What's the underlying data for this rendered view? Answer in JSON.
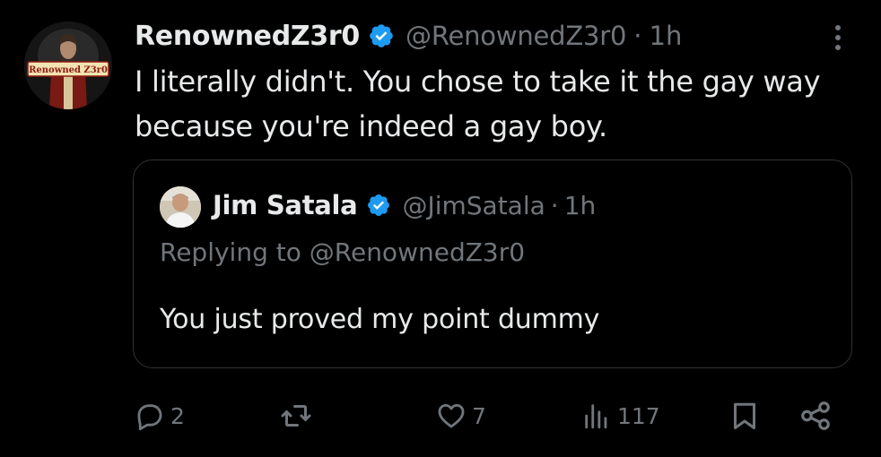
{
  "tweet": {
    "display_name": "RenownedZ3r0",
    "handle": "@RenownedZ3r0",
    "separator": "·",
    "time": "1h",
    "avatar_text": "Renowned Z3r0",
    "text": "I literally didn't. You chose to take it the gay way because you're indeed a gay boy."
  },
  "quote": {
    "display_name": "Jim Satala",
    "handle": "@JimSatala",
    "separator": "·",
    "time": "1h",
    "replying_to_label": "Replying to",
    "replying_to_handle": "@RenownedZ3r0",
    "text": "You just proved my point dummy"
  },
  "actions": {
    "reply_count": "2",
    "repost_count": "",
    "like_count": "7",
    "views_count": "117"
  },
  "colors": {
    "background": "#000000",
    "primary_text": "#e7e9ea",
    "secondary_text": "#71767b",
    "verified_blue": "#1d9bf0",
    "border": "#2f3336"
  },
  "icons": {
    "verified": "verified-badge-icon",
    "more": "more-vertical-icon",
    "reply": "reply-icon",
    "repost": "repost-icon",
    "like": "heart-icon",
    "views": "views-icon",
    "bookmark": "bookmark-icon",
    "share": "share-icon"
  }
}
